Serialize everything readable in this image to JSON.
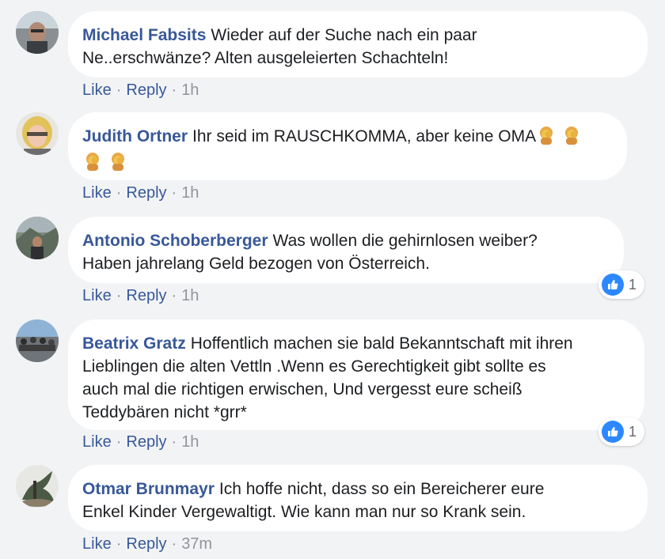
{
  "comments": [
    {
      "author": "Michael Fabsits",
      "text": "Wieder auf der Suche nach ein paar Ne..erschwänze? Alten ausgeleierten Schachteln!",
      "line1": "Wieder auf der Suche nach ein paar",
      "line2": "Ne..erschwänze? Alten ausgeleierten Schachteln!",
      "like": "Like",
      "reply": "Reply",
      "time": "1h"
    },
    {
      "author": "Judith Ortner",
      "text": "Ihr seid im RAUSCHKOMMA, aber keine OMA",
      "line1": "Ihr seid im RAUSCHKOMMA, aber keine OMA",
      "emojis": [
        "woman-facepalming",
        "woman-facepalming",
        "woman-facepalming",
        "woman-facepalming"
      ],
      "like": "Like",
      "reply": "Reply",
      "time": "1h"
    },
    {
      "author": "Antonio Schoberberger",
      "text": "Was wollen die gehirnlosen weiber? Haben jahrelang Geld bezogen von Österreich.",
      "line1": "Was wollen die gehirnlosen weiber?",
      "line2": "Haben jahrelang Geld bezogen von Österreich.",
      "like": "Like",
      "reply": "Reply",
      "time": "1h",
      "reaction_count": "1"
    },
    {
      "author": "Beatrix Gratz",
      "text": "Hoffentlich machen sie bald Bekanntschaft mit ihren Lieblingen die alten Vettln .Wenn es Gerechtigkeit gibt sollte es auch mal die richtigen erwischen, Und vergesst eure scheiß Teddybären nicht *grr*",
      "line1": "Hoffentlich machen sie bald Bekanntschaft mit ihren",
      "line2": "Lieblingen die alten Vettln .Wenn es Gerechtigkeit gibt sollte es",
      "line3": "auch mal die richtigen erwischen, Und vergesst eure scheiß",
      "line4": "Teddybären nicht *grr*",
      "like": "Like",
      "reply": "Reply",
      "time": "1h",
      "reaction_count": "1"
    },
    {
      "author": "Otmar Brunmayr",
      "text": "Ich hoffe nicht, dass so ein Bereicherer eure Enkel Kinder Vergewaltigt. Wie kann man nur so Krank sein.",
      "line1": "Ich hoffe nicht, dass so ein Bereicherer eure",
      "line2": "Enkel Kinder Vergewaltigt. Wie kann man nur so Krank sein.",
      "like": "Like",
      "reply": "Reply",
      "time": "37m"
    }
  ],
  "separator": "·",
  "colors": {
    "background": "#f2f3f5",
    "bubble": "#ffffff",
    "author": "#385898",
    "link": "#385898",
    "meta": "#90949c",
    "like_badge": "#2d88ff"
  },
  "icons": {
    "reaction": "thumbs-up-icon",
    "emoji": "woman-facepalming-emoji"
  }
}
